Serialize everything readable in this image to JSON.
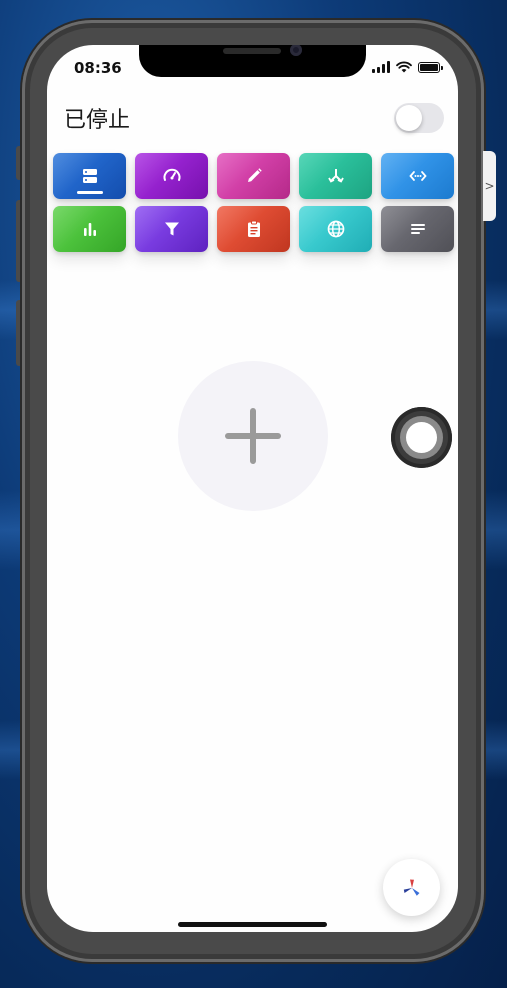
{
  "status_bar": {
    "time": "08:36"
  },
  "header": {
    "status_label": "已停止",
    "toggle_on": false
  },
  "tools": [
    {
      "name": "server",
      "icon": "server-icon",
      "color_a": "#2a74d8",
      "color_b": "#1552b8",
      "active": true
    },
    {
      "name": "speed",
      "icon": "speedometer-icon",
      "color_a": "#a82ee0",
      "color_b": "#7e12b8",
      "active": false
    },
    {
      "name": "edit",
      "icon": "pencil-icon",
      "color_a": "#e04fb8",
      "color_b": "#c02c92",
      "active": false
    },
    {
      "name": "routing",
      "icon": "split-arrows-icon",
      "color_a": "#33cda8",
      "color_b": "#1fae8a",
      "active": false
    },
    {
      "name": "code",
      "icon": "code-icon",
      "color_a": "#3fa0f0",
      "color_b": "#1e82dc",
      "active": false
    },
    {
      "name": "stats",
      "icon": "bar-chart-icon",
      "color_a": "#5cd04a",
      "color_b": "#38b02a",
      "active": false
    },
    {
      "name": "filter",
      "icon": "filter-icon",
      "color_a": "#8a4ef0",
      "color_b": "#6424cc",
      "active": false
    },
    {
      "name": "clipboard",
      "icon": "clipboard-icon",
      "color_a": "#ee5a40",
      "color_b": "#cc3a22",
      "active": false
    },
    {
      "name": "network",
      "icon": "globe-icon",
      "color_a": "#4ad7d8",
      "color_b": "#22b8c0",
      "active": false
    },
    {
      "name": "logs",
      "icon": "lines-icon",
      "color_a": "#76767e",
      "color_b": "#55555c",
      "active": false
    }
  ],
  "colors": {
    "screen_bg": "#fefefe",
    "add_circle": "#f4f3f8",
    "plus": "#9a9a9a"
  }
}
